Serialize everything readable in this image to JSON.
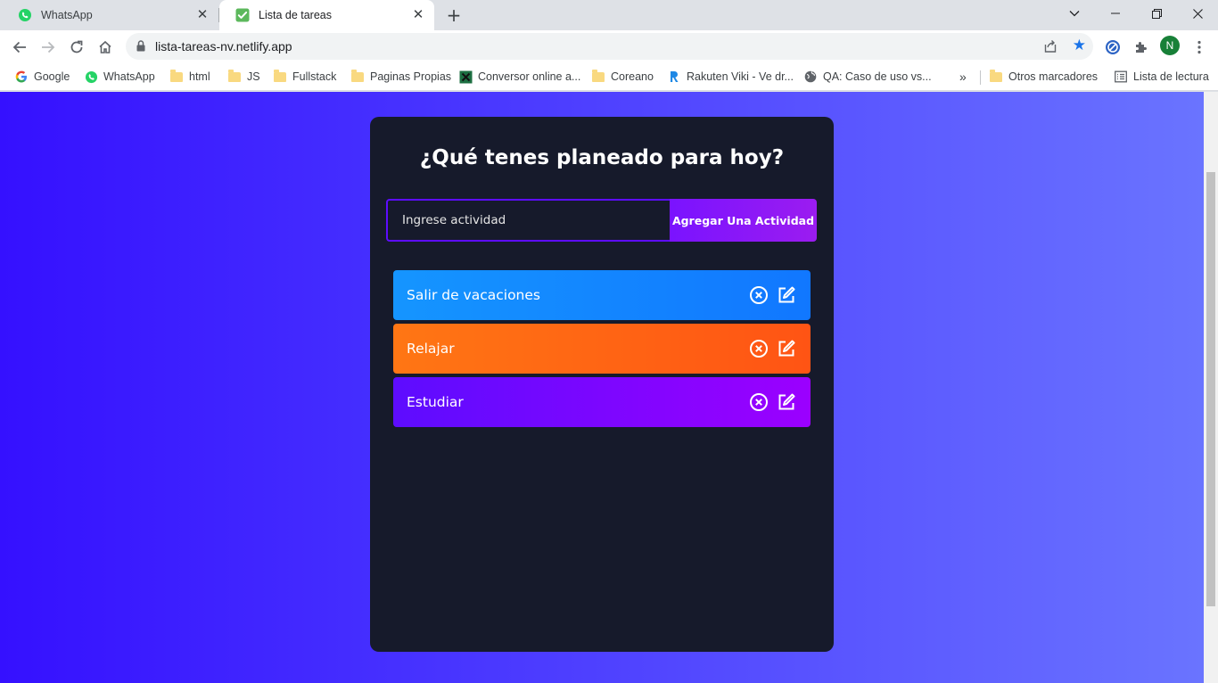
{
  "browser": {
    "tabs": [
      {
        "title": "WhatsApp",
        "icon": "whatsapp-icon"
      },
      {
        "title": "Lista de tareas",
        "icon": "checkmark-icon"
      }
    ],
    "url": "lista-tareas-nv.netlify.app",
    "profile_initial": "N",
    "bookmarks": [
      "Google",
      "WhatsApp",
      "html",
      "JS",
      "Fullstack",
      "Paginas Propias",
      "Conversor online a...",
      "Coreano",
      "Rakuten Viki - Ve dr...",
      "QA: Caso de uso vs...",
      "Otros marcadores",
      "Lista de lectura"
    ]
  },
  "app": {
    "title": "¿Qué tenes planeado para hoy?",
    "input_placeholder": "Ingrese actividad",
    "add_button": "Agregar Una Actividad",
    "tasks": [
      {
        "text": "Salir de vacaciones",
        "color": "#1595ff"
      },
      {
        "text": "Relajar",
        "color": "#ff7614"
      },
      {
        "text": "Estudiar",
        "color": "#7a0cff"
      }
    ]
  },
  "colors": {
    "background_gradient": [
      "#3510ff",
      "#6a74ff"
    ],
    "card": "#161a2b",
    "accent": "#5d0cff"
  }
}
